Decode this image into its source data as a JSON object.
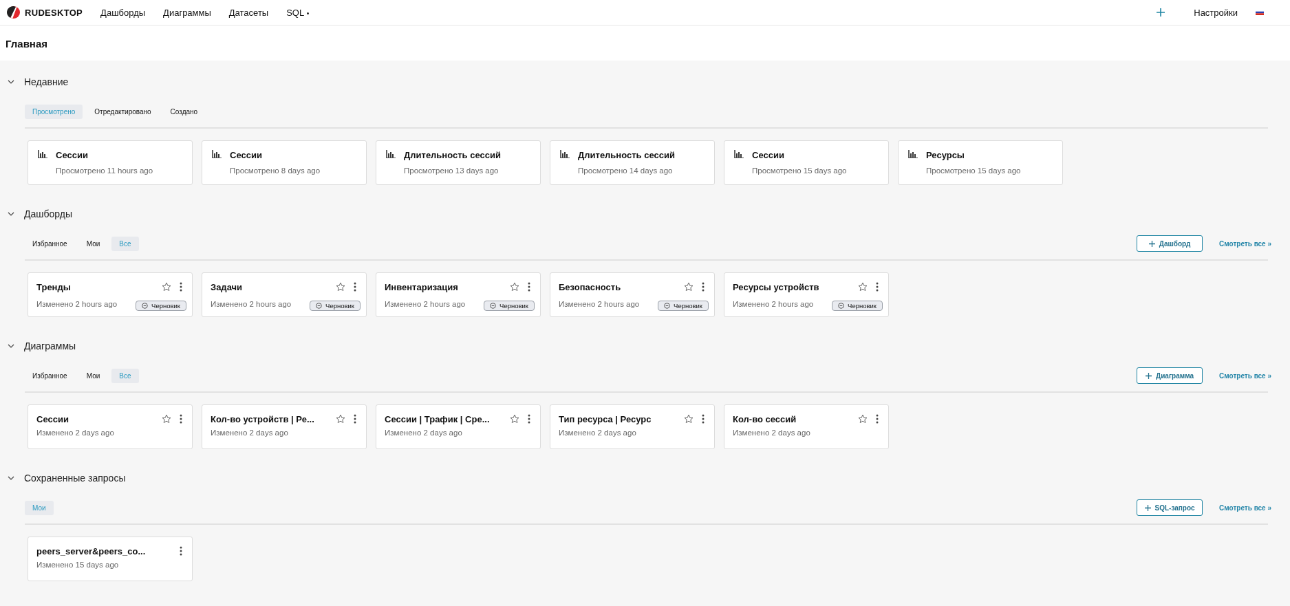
{
  "nav": {
    "brand": "RUDESKTOP",
    "items": [
      {
        "label": "Дашборды",
        "dropdown": false
      },
      {
        "label": "Диаграммы",
        "dropdown": false
      },
      {
        "label": "Датасеты",
        "dropdown": false
      },
      {
        "label": "SQL",
        "dropdown": true
      }
    ],
    "settings": "Настройки"
  },
  "page_title": "Главная",
  "sections": [
    {
      "title": "Недавние",
      "expanded": true,
      "kind": "recent",
      "tabs": [
        {
          "label": "Просмотрено",
          "selected": true
        },
        {
          "label": "Отредактировано",
          "selected": false
        },
        {
          "label": "Создано",
          "selected": false
        }
      ],
      "cards": [
        {
          "title": "Сессии",
          "subtitle": "Просмотрено 11 hours ago"
        },
        {
          "title": "Сессии",
          "subtitle": "Просмотрено 8 days ago"
        },
        {
          "title": "Длительность сессий",
          "subtitle": "Просмотрено 13 days ago"
        },
        {
          "title": "Длительность сессий",
          "subtitle": "Просмотрено 14 days ago"
        },
        {
          "title": "Сессии",
          "subtitle": "Просмотрено 15 days ago"
        },
        {
          "title": "Ресурсы",
          "subtitle": "Просмотрено 15 days ago"
        }
      ]
    },
    {
      "title": "Дашборды",
      "expanded": true,
      "kind": "items",
      "tabs": [
        {
          "label": "Избранное",
          "selected": false
        },
        {
          "label": "Мои",
          "selected": false
        },
        {
          "label": "Все",
          "selected": true
        }
      ],
      "button": {
        "label": "Дашборд"
      },
      "view_all": "Смотреть все »",
      "cards": [
        {
          "title": "Тренды",
          "subtitle": "Изменено 2 hours ago",
          "starred": false,
          "badge": "Черновик"
        },
        {
          "title": "Задачи",
          "subtitle": "Изменено 2 hours ago",
          "starred": false,
          "badge": "Черновик"
        },
        {
          "title": "Инвентаризация",
          "subtitle": "Изменено 2 hours ago",
          "starred": false,
          "badge": "Черновик"
        },
        {
          "title": "Безопасность",
          "subtitle": "Изменено 2 hours ago",
          "starred": false,
          "badge": "Черновик"
        },
        {
          "title": "Ресурсы устройств",
          "subtitle": "Изменено 2 hours ago",
          "starred": false,
          "badge": "Черновик"
        }
      ]
    },
    {
      "title": "Диаграммы",
      "expanded": true,
      "kind": "items",
      "tabs": [
        {
          "label": "Избранное",
          "selected": false
        },
        {
          "label": "Мои",
          "selected": false
        },
        {
          "label": "Все",
          "selected": true
        }
      ],
      "button": {
        "label": "Диаграмма"
      },
      "view_all": "Смотреть все »",
      "cards": [
        {
          "title": "Сессии",
          "subtitle": "Изменено 2 days ago",
          "starred": false
        },
        {
          "title": "Кол-во устройств | Ре...",
          "subtitle": "Изменено 2 days ago",
          "starred": false
        },
        {
          "title": "Сессии | Трафик | Сре...",
          "subtitle": "Изменено 2 days ago",
          "starred": false
        },
        {
          "title": "Тип ресурса | Ресурс",
          "subtitle": "Изменено 2 days ago",
          "starred": false
        },
        {
          "title": "Кол-во сессий",
          "subtitle": "Изменено 2 days ago",
          "starred": false
        }
      ]
    },
    {
      "title": "Сохраненные запросы",
      "expanded": true,
      "kind": "items",
      "tabs": [
        {
          "label": "Мои",
          "selected": true
        }
      ],
      "button": {
        "label": "SQL-запрос"
      },
      "view_all": "Смотреть все »",
      "cards": [
        {
          "title": "peers_server&peers_co...",
          "subtitle": "Изменено 15 days ago"
        }
      ]
    }
  ]
}
